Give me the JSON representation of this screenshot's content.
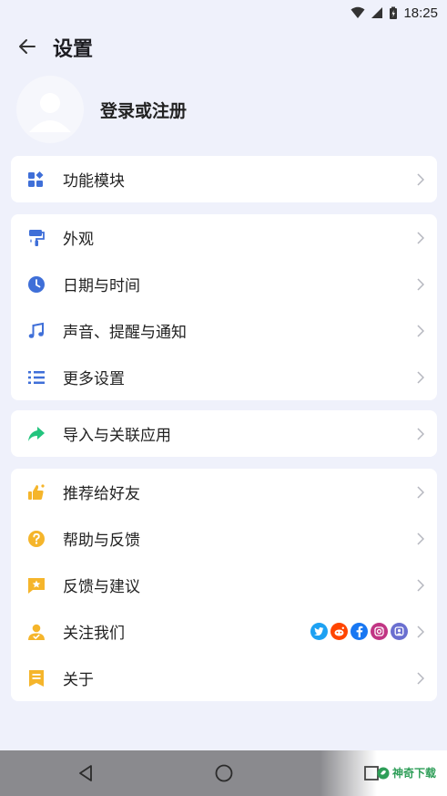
{
  "status": {
    "time": "18:25"
  },
  "header": {
    "title": "设置"
  },
  "profile": {
    "login_label": "登录或注册"
  },
  "sections": [
    {
      "items": [
        {
          "label": "功能模块",
          "icon": "grid-modules-icon"
        }
      ]
    },
    {
      "items": [
        {
          "label": "外观",
          "icon": "paint-roller-icon"
        },
        {
          "label": "日期与时间",
          "icon": "clock-icon"
        },
        {
          "label": "声音、提醒与通知",
          "icon": "music-note-icon"
        },
        {
          "label": "更多设置",
          "icon": "list-settings-icon"
        }
      ]
    },
    {
      "items": [
        {
          "label": "导入与关联应用",
          "icon": "share-arrow-icon"
        }
      ]
    },
    {
      "items": [
        {
          "label": "推荐给好友",
          "icon": "thumbs-up-icon"
        },
        {
          "label": "帮助与反馈",
          "icon": "help-circle-icon"
        },
        {
          "label": "反馈与建议",
          "icon": "feedback-star-icon"
        },
        {
          "label": "关注我们",
          "icon": "follow-user-icon"
        },
        {
          "label": "关于",
          "icon": "about-note-icon"
        }
      ]
    }
  ],
  "social_icons": [
    "twitter-icon",
    "reddit-icon",
    "facebook-icon",
    "instagram-icon",
    "mastodon-icon"
  ],
  "colors": {
    "background": "#eff1fb",
    "blue": "#3f6fd8",
    "green": "#23c47e",
    "yellow": "#f5b52b",
    "twitter": "#1da1f2",
    "reddit": "#ff4500",
    "facebook": "#1877f2",
    "instagram": "#c13584",
    "mastodon": "#6a6fd0"
  },
  "navigation": {
    "watermark": "神奇下载"
  }
}
